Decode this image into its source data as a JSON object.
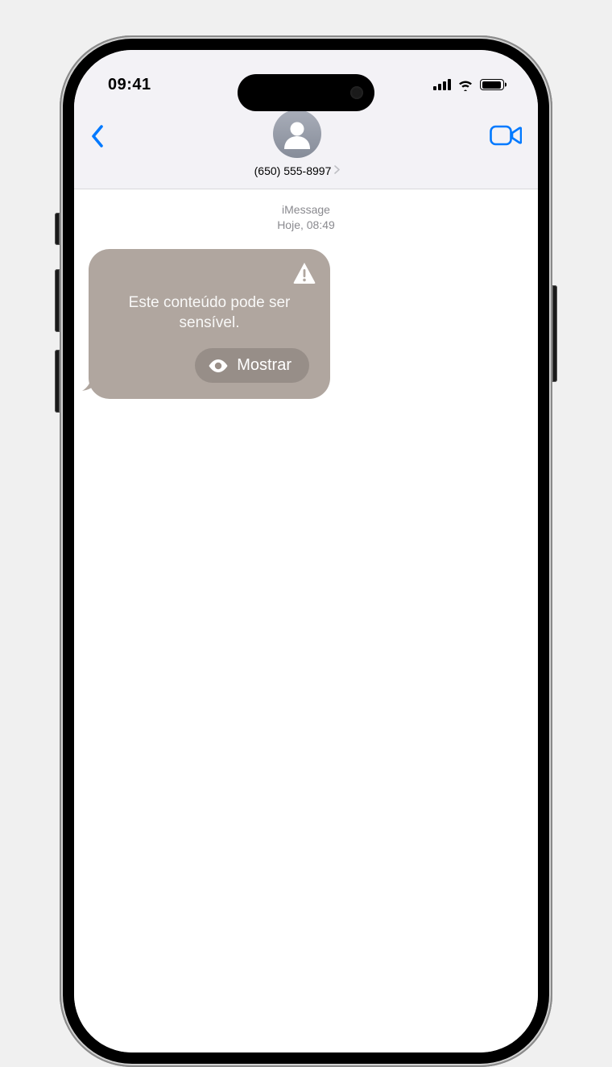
{
  "status": {
    "time": "09:41"
  },
  "header": {
    "contact_phone": "(650) 555-8997"
  },
  "thread": {
    "service_label": "iMessage",
    "timestamp": "Hoje, 08:49",
    "sensitive_message": "Este conteúdo pode ser sensível.",
    "show_button_label": "Mostrar"
  },
  "icons": {
    "back": "chevron-left-icon",
    "video": "video-camera-icon",
    "avatar": "person-silhouette-icon",
    "warning": "warning-triangle-icon",
    "eye": "eye-icon",
    "cell": "cellular-signal-icon",
    "wifi": "wifi-icon",
    "battery": "battery-icon"
  },
  "colors": {
    "accent": "#0079ff",
    "bubble_bg": "#b0a69f",
    "header_bg": "#f3f2f6"
  }
}
